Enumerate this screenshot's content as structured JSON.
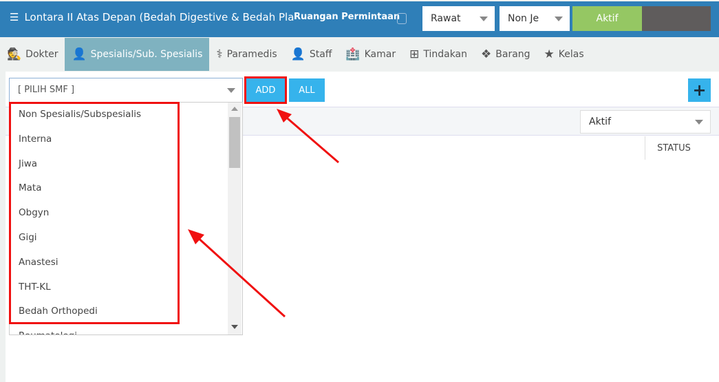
{
  "header": {
    "title": "Lontara II Atas Depan (Bedah Digestive & Bedah Pla",
    "ruangan_label": "Ruangan Permintaan",
    "rawat": "Rawat",
    "non_je": "Non Je",
    "aktif": "Aktif"
  },
  "tabs": [
    {
      "label": "Dokter",
      "icon": "user-secret-icon"
    },
    {
      "label": "Spesialis/Sub. Spesialis",
      "icon": "user-md-icon",
      "active": true
    },
    {
      "label": "Paramedis",
      "icon": "stethoscope-icon"
    },
    {
      "label": "Staff",
      "icon": "user-icon"
    },
    {
      "label": "Kamar",
      "icon": "hospital-icon"
    },
    {
      "label": "Tindakan",
      "icon": "medkit-icon"
    },
    {
      "label": "Barang",
      "icon": "cubes-icon"
    },
    {
      "label": "Kelas",
      "icon": "star-icon"
    }
  ],
  "toolbar": {
    "smf_placeholder": "[ PILIH SMF ]",
    "add": "ADD",
    "all": "ALL",
    "plus": "+"
  },
  "filter": {
    "status_value": "Aktif"
  },
  "table": {
    "status_header": "STATUS"
  },
  "dropdown": {
    "items": [
      "Non Spesialis/Subspesialis",
      "Interna",
      "Jiwa",
      "Mata",
      "Obgyn",
      "Gigi",
      "Anastesi",
      "THT-KL",
      "Bedah Orthopedi",
      "Reumatologi"
    ]
  },
  "colors": {
    "header": "#2f7fb8",
    "active_tab": "#7fb2c0",
    "button": "#36b3ec",
    "aktif": "#95c763",
    "highlight": "#f01010"
  }
}
